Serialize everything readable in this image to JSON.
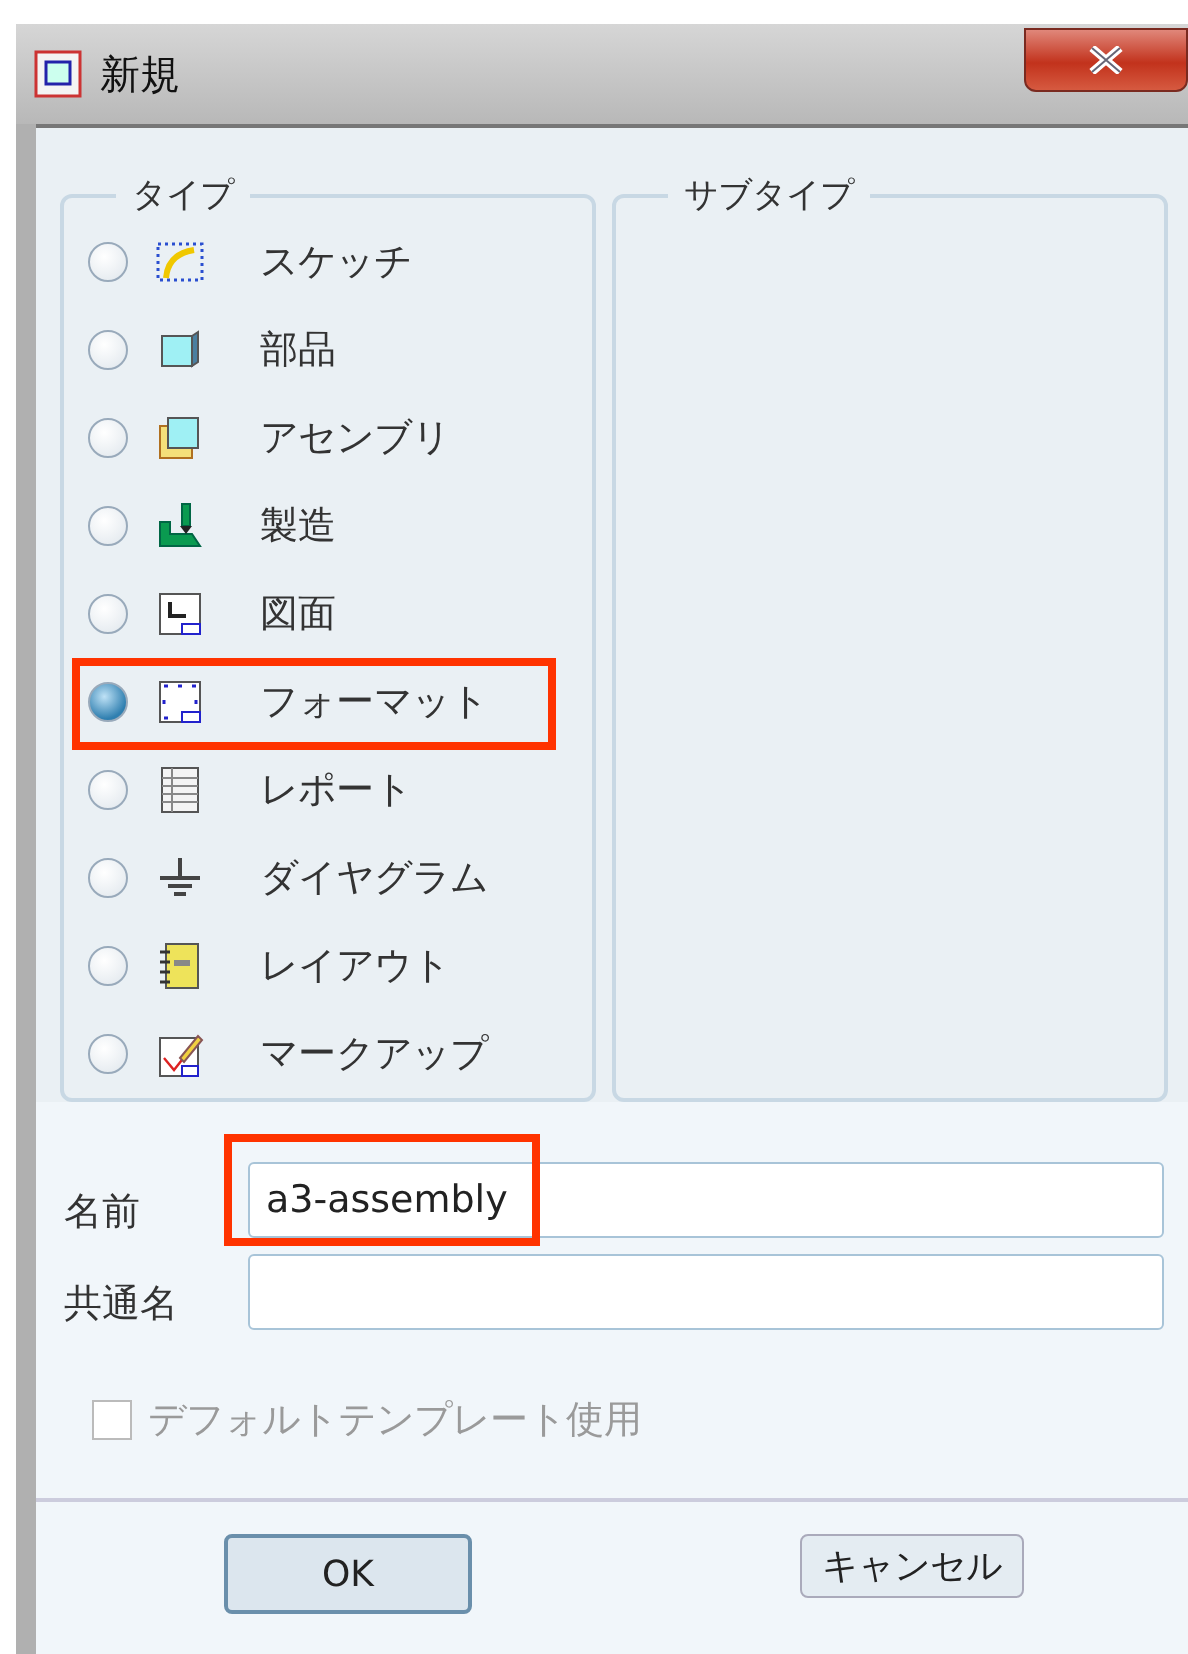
{
  "window": {
    "title": "新規"
  },
  "type_group": {
    "label": "タイプ",
    "items": [
      {
        "label": "スケッチ",
        "selected": false,
        "highlighted": false
      },
      {
        "label": "部品",
        "selected": false,
        "highlighted": false
      },
      {
        "label": "アセンブリ",
        "selected": false,
        "highlighted": false
      },
      {
        "label": "製造",
        "selected": false,
        "highlighted": false
      },
      {
        "label": "図面",
        "selected": false,
        "highlighted": false
      },
      {
        "label": "フォーマット",
        "selected": true,
        "highlighted": true
      },
      {
        "label": "レポート",
        "selected": false,
        "highlighted": false
      },
      {
        "label": "ダイヤグラム",
        "selected": false,
        "highlighted": false
      },
      {
        "label": "レイアウト",
        "selected": false,
        "highlighted": false
      },
      {
        "label": "マークアップ",
        "selected": false,
        "highlighted": false
      }
    ]
  },
  "subtype_group": {
    "label": "サブタイプ"
  },
  "fields": [
    {
      "label": "名前",
      "value": "a3-assembly",
      "highlighted": true
    },
    {
      "label": "共通名",
      "highlighted": false
    }
  ],
  "default_template": {
    "label": "デフォルトテンプレート使用",
    "checked": false,
    "disabled": true
  },
  "buttons": [
    {
      "label": "OK",
      "default": true
    },
    {
      "label": "キャンセル",
      "default": false
    }
  ]
}
